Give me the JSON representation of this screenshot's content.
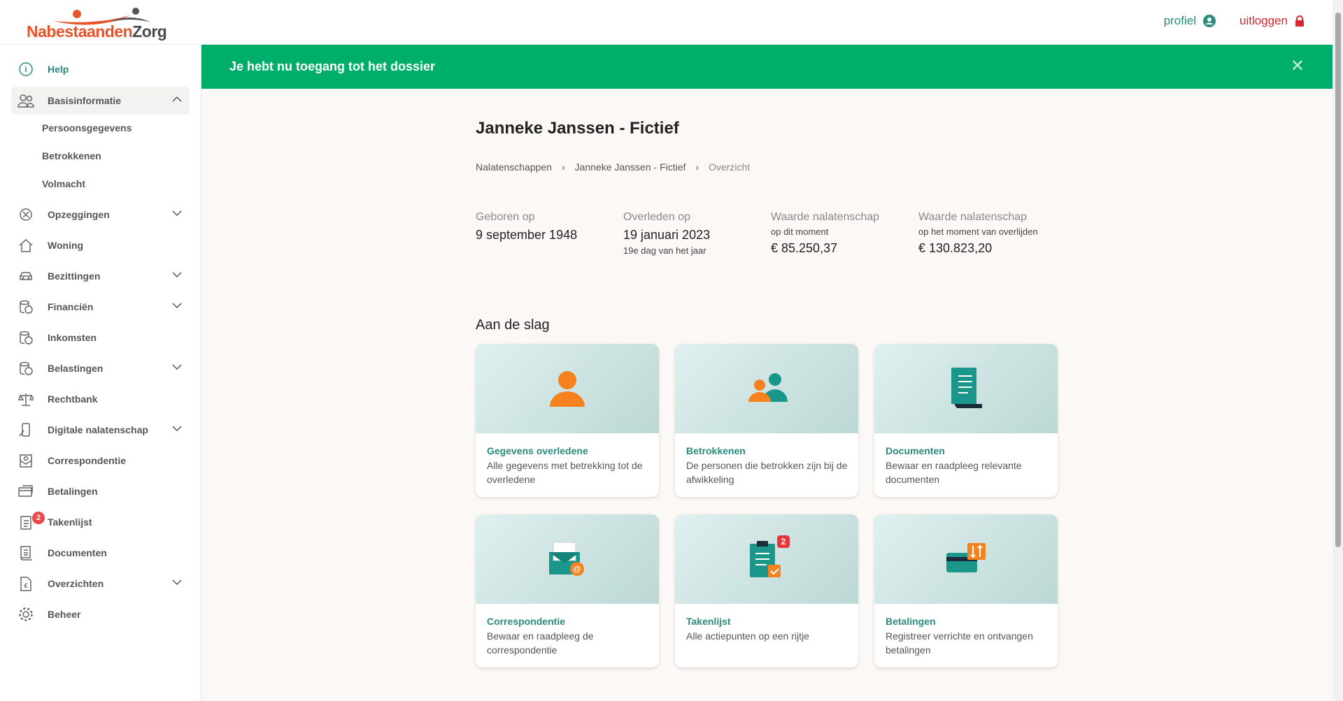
{
  "header": {
    "logo_text_a": "Nabestaanden",
    "logo_text_b": "Zorg",
    "profile": "profiel",
    "logout": "uitloggen"
  },
  "banner": {
    "message": "Je hebt nu toegang tot het dossier"
  },
  "sidebar": {
    "items": [
      {
        "label": "Help",
        "icon": "info-icon"
      },
      {
        "label": "Basisinformatie",
        "icon": "users-icon",
        "expanded": true,
        "children": [
          "Persoonsgegevens",
          "Betrokkenen",
          "Volmacht"
        ]
      },
      {
        "label": "Opzeggingen",
        "icon": "cancel-icon"
      },
      {
        "label": "Woning",
        "icon": "house-icon"
      },
      {
        "label": "Bezittingen",
        "icon": "car-icon"
      },
      {
        "label": "Financiën",
        "icon": "coins-icon"
      },
      {
        "label": "Inkomsten",
        "icon": "coins-icon"
      },
      {
        "label": "Belastingen",
        "icon": "coins-icon"
      },
      {
        "label": "Rechtbank",
        "icon": "scale-icon"
      },
      {
        "label": "Digitale nalatenschap",
        "icon": "device-icon"
      },
      {
        "label": "Correspondentie",
        "icon": "mail-icon"
      },
      {
        "label": "Betalingen",
        "icon": "card-icon"
      },
      {
        "label": "Takenlijst",
        "icon": "clipboard-icon",
        "badge": "2"
      },
      {
        "label": "Documenten",
        "icon": "document-icon"
      },
      {
        "label": "Overzichten",
        "icon": "euro-doc-icon"
      },
      {
        "label": "Beheer",
        "icon": "gear-icon"
      }
    ]
  },
  "main": {
    "title": "Janneke Janssen - Fictief",
    "breadcrumb": [
      "Nalatenschappen",
      "Janneke Janssen - Fictief",
      "Overzicht"
    ],
    "stats": [
      {
        "label": "Geboren op",
        "sub": "",
        "value": "9 september 1948",
        "note": ""
      },
      {
        "label": "Overleden op",
        "sub": "",
        "value": "19 januari 2023",
        "note": "19e dag van het jaar"
      },
      {
        "label": "Waarde nalatenschap",
        "sub": "op dit moment",
        "value": "€ 85.250,37",
        "note": ""
      },
      {
        "label": "Waarde nalatenschap",
        "sub": "op het moment van overlijden",
        "value": "€ 130.823,20",
        "note": ""
      }
    ],
    "section_title": "Aan de slag",
    "cards": [
      {
        "title": "Gegevens overledene",
        "desc": "Alle gegevens met betrekking tot de overledene"
      },
      {
        "title": "Betrokkenen",
        "desc": "De personen die betrokken zijn bij de afwikkeling"
      },
      {
        "title": "Documenten",
        "desc": "Bewaar en raadpleeg relevante documenten"
      },
      {
        "title": "Correspondentie",
        "desc": "Bewaar en raadpleeg de correspondentie"
      },
      {
        "title": "Takenlijst",
        "desc": "Alle actiepunten op een rijtje",
        "badge": "2"
      },
      {
        "title": "Betalingen",
        "desc": "Registreer verrichte en ontvangen betalingen"
      }
    ]
  },
  "colors": {
    "teal": "#2a8a7e",
    "green": "#00ae6b",
    "orange": "#f5821f",
    "red": "#d7282f"
  }
}
